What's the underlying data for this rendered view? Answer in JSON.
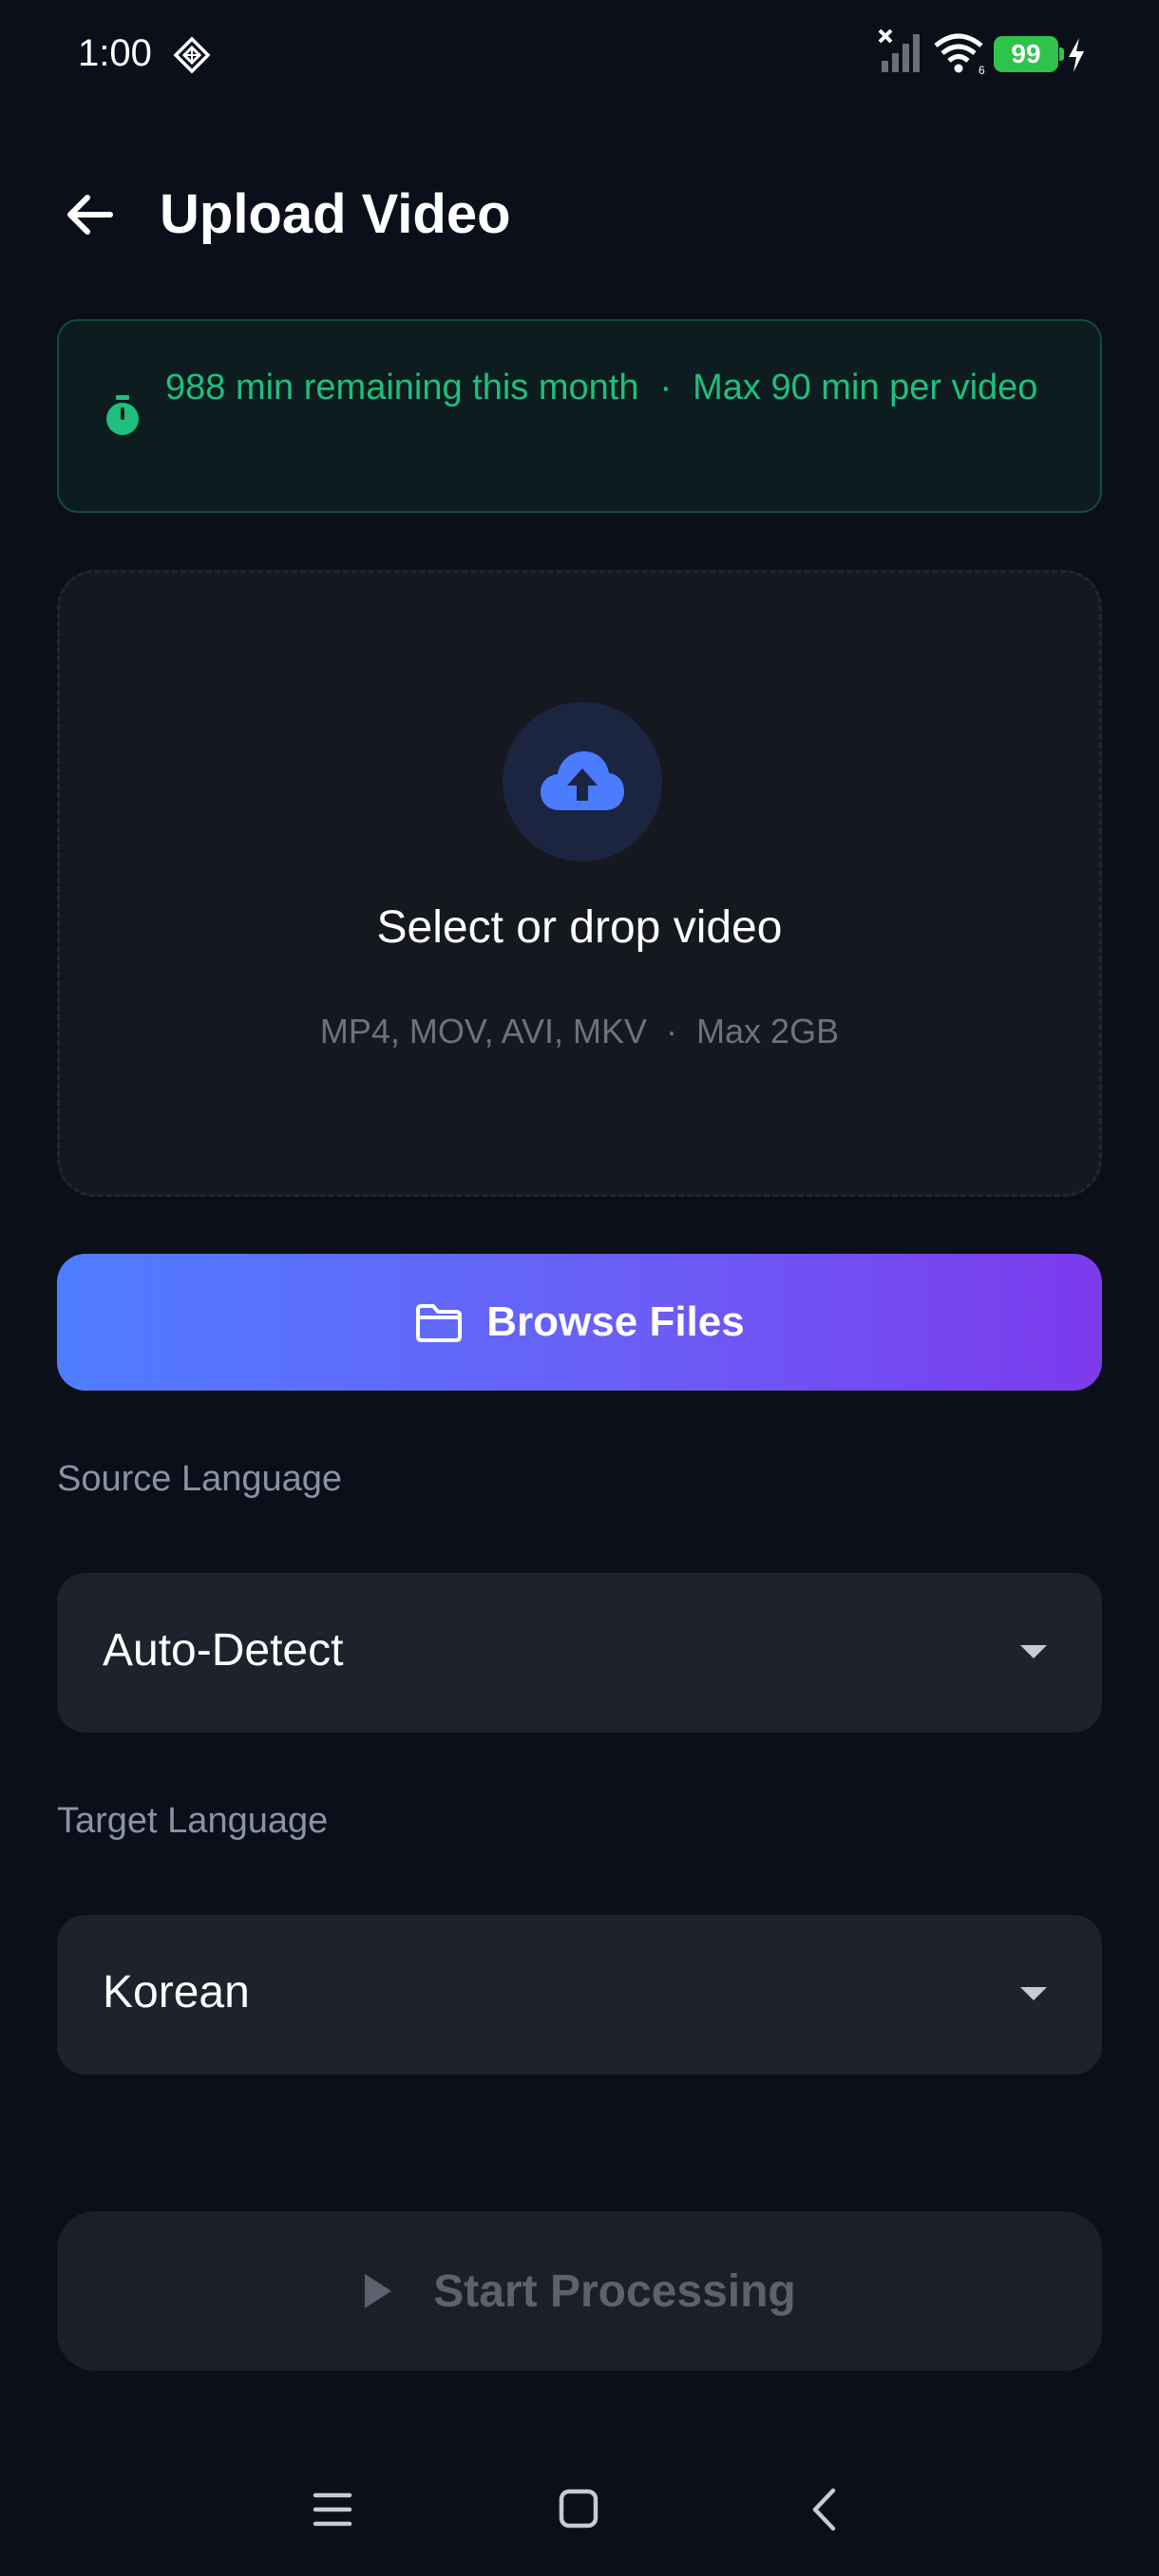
{
  "status_bar": {
    "time": "1:00",
    "battery": "99"
  },
  "header": {
    "title": "Upload Video"
  },
  "quota": {
    "remaining_text": "988 min remaining this month",
    "separator": "·",
    "max_text": "Max 90 min per video"
  },
  "dropzone": {
    "title": "Select or drop video",
    "formats": "MP4, MOV, AVI, MKV",
    "separator": "·",
    "max_size": "Max 2GB"
  },
  "browse": {
    "label": "Browse Files"
  },
  "source_language": {
    "label": "Source Language",
    "value": "Auto-Detect"
  },
  "target_language": {
    "label": "Target Language",
    "value": "Korean"
  },
  "start": {
    "label": "Start Processing"
  },
  "colors": {
    "background": "#0b0f1a",
    "accent_green": "#1fbf7d",
    "gradient_start": "#4f7dff",
    "gradient_end": "#7c3aed",
    "battery_green": "#2fc34b"
  },
  "icons": [
    "diamond-icon",
    "signal-icon",
    "wifi-icon",
    "battery-icon",
    "charging-icon",
    "back-arrow-icon",
    "stopwatch-icon",
    "cloud-upload-icon",
    "folder-icon",
    "dropdown-caret-icon",
    "play-icon",
    "menu-icon",
    "home-icon",
    "back-nav-icon"
  ]
}
